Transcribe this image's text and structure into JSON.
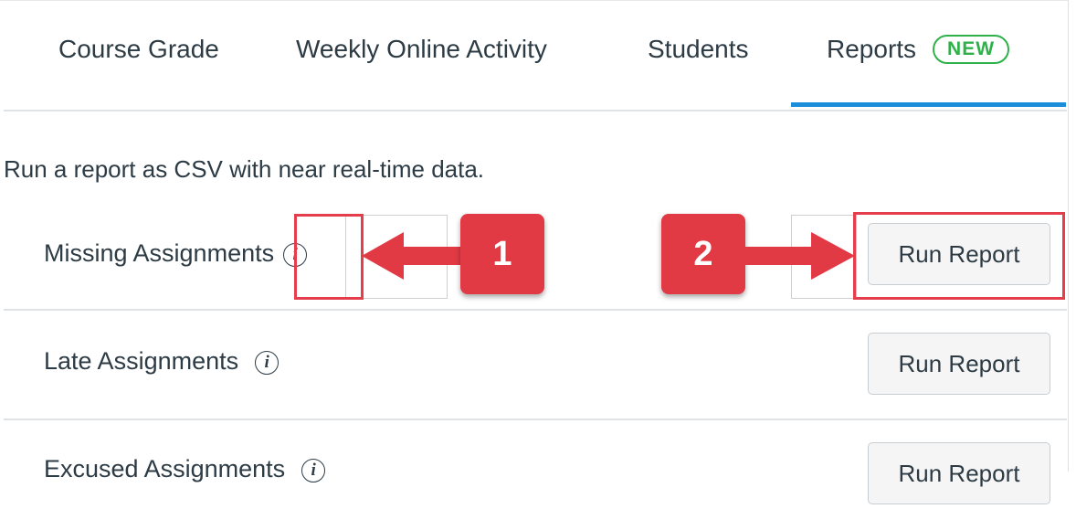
{
  "tabs": [
    {
      "label": "Course Grade"
    },
    {
      "label": "Weekly Online Activity"
    },
    {
      "label": "Students"
    },
    {
      "label": "Reports",
      "badge": "NEW",
      "active": true
    }
  ],
  "intro_text": "Run a report as CSV with near real-time data.",
  "reports": [
    {
      "label": "Missing Assignments",
      "info_icon": "info-icon",
      "button_label": "Run Report"
    },
    {
      "label": "Late Assignments",
      "info_icon": "info-icon",
      "button_label": "Run Report"
    },
    {
      "label": "Excused Assignments",
      "info_icon": "info-icon",
      "button_label": "Run Report"
    }
  ],
  "callouts": [
    {
      "number": "1"
    },
    {
      "number": "2"
    }
  ],
  "colors": {
    "accent_tab": "#1a8ed8",
    "badge_green": "#2fb14a",
    "callout_red": "#e23a45"
  }
}
